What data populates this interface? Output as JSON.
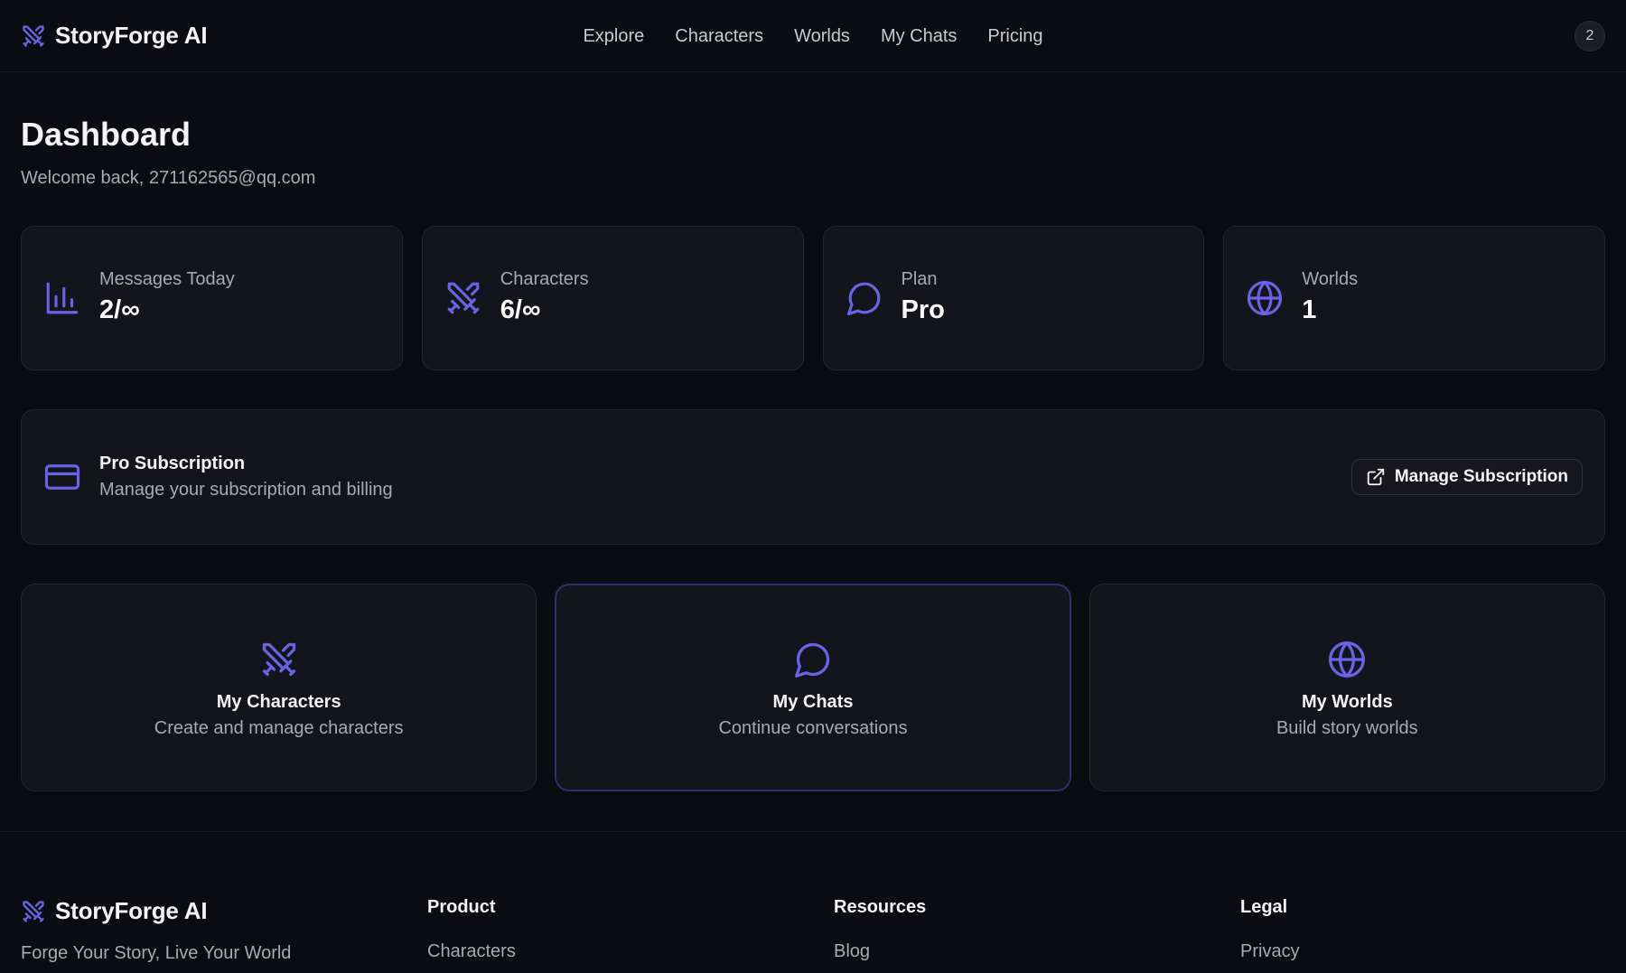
{
  "header": {
    "brand": "StoryForge AI",
    "nav": [
      "Explore",
      "Characters",
      "Worlds",
      "My Chats",
      "Pricing"
    ],
    "avatar_text": "2"
  },
  "dashboard": {
    "title": "Dashboard",
    "welcome": "Welcome back, 271162565@qq.com"
  },
  "stats": [
    {
      "label": "Messages Today",
      "value": "2/∞",
      "icon": "bar-chart-icon"
    },
    {
      "label": "Characters",
      "value": "6/∞",
      "icon": "swords-icon"
    },
    {
      "label": "Plan",
      "value": "Pro",
      "icon": "chat-bubble-icon"
    },
    {
      "label": "Worlds",
      "value": "1",
      "icon": "globe-icon"
    }
  ],
  "subscription": {
    "title": "Pro Subscription",
    "description": "Manage your subscription and billing",
    "button_label": "Manage Subscription"
  },
  "actions": [
    {
      "title": "My Characters",
      "description": "Create and manage characters",
      "icon": "swords-icon"
    },
    {
      "title": "My Chats",
      "description": "Continue conversations",
      "icon": "chat-bubble-icon"
    },
    {
      "title": "My Worlds",
      "description": "Build story worlds",
      "icon": "globe-icon"
    }
  ],
  "footer": {
    "brand": "StoryForge AI",
    "tagline": "Forge Your Story, Live Your World",
    "columns": [
      {
        "heading": "Product",
        "first_link": "Characters"
      },
      {
        "heading": "Resources",
        "first_link": "Blog"
      },
      {
        "heading": "Legal",
        "first_link": "Privacy"
      }
    ]
  },
  "colors": {
    "accent": "#6a63e6",
    "background": "#0b0b12",
    "card": "#14141c",
    "border": "#25252f",
    "text_muted": "#a9a9b3"
  }
}
